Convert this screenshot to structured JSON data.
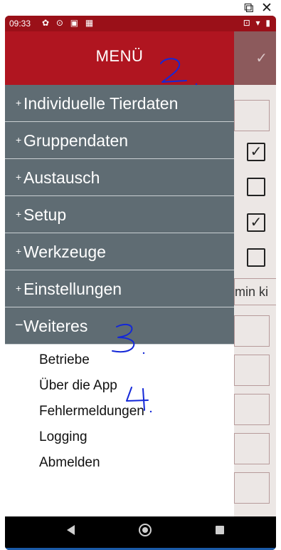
{
  "window": {
    "popout_icon": "external-window-icon",
    "close_glyph": "✕"
  },
  "status_bar": {
    "time": "09:33",
    "left_icons": "✿ ⊙ ▣ ▦",
    "right_icons": "⊡ ▾ ▮"
  },
  "drawer": {
    "title": "MENÜ",
    "items": [
      {
        "sign": "+",
        "label": "Individuelle Tierdaten"
      },
      {
        "sign": "+",
        "label": "Gruppendaten"
      },
      {
        "sign": "+",
        "label": "Austausch"
      },
      {
        "sign": "+",
        "label": "Setup"
      },
      {
        "sign": "+",
        "label": "Werkzeuge"
      },
      {
        "sign": "+",
        "label": "Einstellungen"
      },
      {
        "sign": "−",
        "label": "Weiteres"
      }
    ],
    "subitems": [
      "Betriebe",
      "Über die App",
      "Fehlermeldungen",
      "Logging",
      "Abmelden"
    ]
  },
  "background": {
    "header_check": "✓",
    "checkbox_glyph": "✓",
    "field_text": "min ki"
  },
  "annotations": {
    "labels": [
      "2",
      "3",
      "4"
    ]
  },
  "colors": {
    "drawer_header": "#b01520",
    "menu_item": "#5f6c73",
    "status_bar": "#9a1018",
    "annotation_ink": "#1428d8"
  }
}
